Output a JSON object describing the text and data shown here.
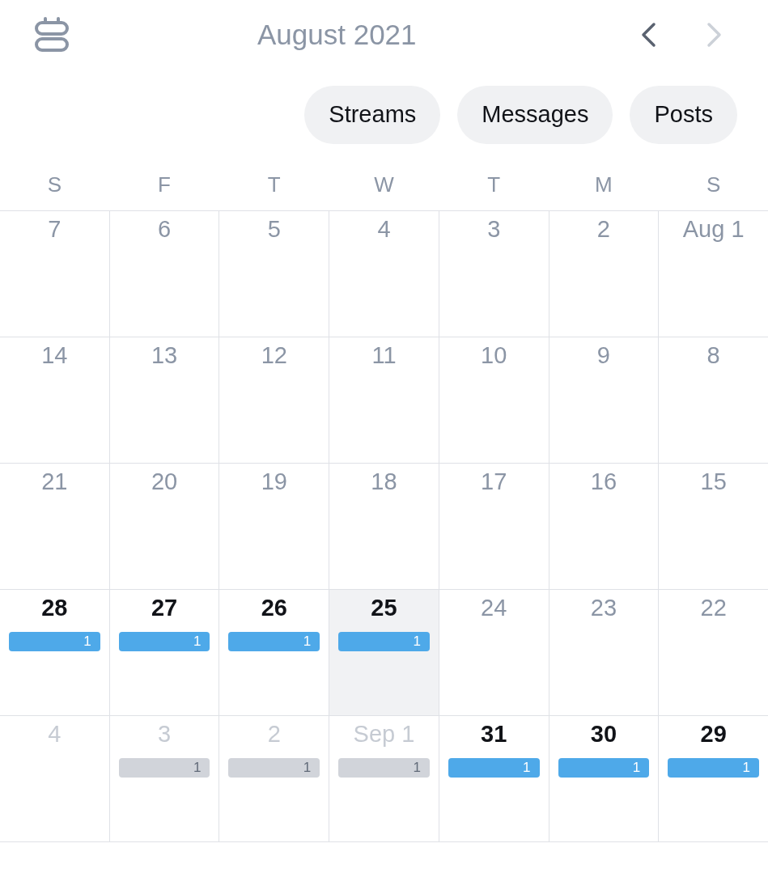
{
  "header": {
    "title": "August 2021",
    "nav": [
      {
        "kind": "prev",
        "disabled": false
      },
      {
        "kind": "next",
        "disabled": true
      }
    ]
  },
  "filters": [
    {
      "label": "Streams",
      "selected": false
    },
    {
      "label": "Messages",
      "selected": false
    },
    {
      "label": "Posts",
      "selected": false
    }
  ],
  "weekdays": [
    "S",
    "F",
    "T",
    "W",
    "T",
    "M",
    "S"
  ],
  "weeks": [
    [
      {
        "label": "7",
        "kind": "past"
      },
      {
        "label": "6",
        "kind": "past"
      },
      {
        "label": "5",
        "kind": "past"
      },
      {
        "label": "4",
        "kind": "past"
      },
      {
        "label": "3",
        "kind": "past"
      },
      {
        "label": "2",
        "kind": "past"
      },
      {
        "label": "Aug 1",
        "kind": "past"
      }
    ],
    [
      {
        "label": "14",
        "kind": "past"
      },
      {
        "label": "13",
        "kind": "past"
      },
      {
        "label": "12",
        "kind": "past"
      },
      {
        "label": "11",
        "kind": "past"
      },
      {
        "label": "10",
        "kind": "past"
      },
      {
        "label": "9",
        "kind": "past"
      },
      {
        "label": "8",
        "kind": "past"
      }
    ],
    [
      {
        "label": "21",
        "kind": "past"
      },
      {
        "label": "20",
        "kind": "past"
      },
      {
        "label": "19",
        "kind": "past"
      },
      {
        "label": "18",
        "kind": "past"
      },
      {
        "label": "17",
        "kind": "past"
      },
      {
        "label": "16",
        "kind": "past"
      },
      {
        "label": "15",
        "kind": "past"
      }
    ],
    [
      {
        "label": "28",
        "kind": "upcoming",
        "count": "1"
      },
      {
        "label": "27",
        "kind": "upcoming",
        "count": "1"
      },
      {
        "label": "26",
        "kind": "upcoming",
        "count": "1"
      },
      {
        "label": "25",
        "kind": "today",
        "count": "1"
      },
      {
        "label": "24",
        "kind": "past"
      },
      {
        "label": "23",
        "kind": "past"
      },
      {
        "label": "22",
        "kind": "past"
      }
    ],
    [
      {
        "label": "4",
        "kind": "next_month"
      },
      {
        "label": "3",
        "kind": "next_month",
        "count": "1"
      },
      {
        "label": "2",
        "kind": "next_month",
        "count": "1"
      },
      {
        "label": "Sep 1",
        "kind": "next_month",
        "count": "1"
      },
      {
        "label": "31",
        "kind": "upcoming",
        "count": "1"
      },
      {
        "label": "30",
        "kind": "upcoming",
        "count": "1"
      },
      {
        "label": "29",
        "kind": "upcoming",
        "count": "1"
      }
    ]
  ]
}
